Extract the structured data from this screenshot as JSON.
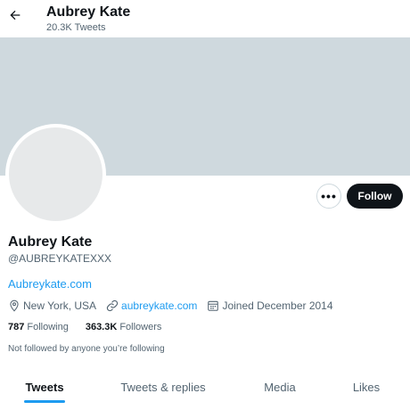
{
  "header": {
    "name": "Aubrey Kate",
    "tweet_count": "20.3K Tweets"
  },
  "actions": {
    "more": "•••",
    "follow": "Follow"
  },
  "profile": {
    "display_name": "Aubrey Kate",
    "handle": "@AUBREYKATEXXX",
    "bio_link": "Aubreykate.com",
    "location": "New York, USA",
    "website": "aubreykate.com",
    "joined": "Joined December 2014",
    "following_count": "787",
    "following_label": "Following",
    "followers_count": "363.3K",
    "followers_label": "Followers",
    "follow_note": "Not followed by anyone you’re following"
  },
  "tabs": [
    {
      "label": "Tweets",
      "active": true
    },
    {
      "label": "Tweets & replies",
      "active": false
    },
    {
      "label": "Media",
      "active": false
    },
    {
      "label": "Likes",
      "active": false
    }
  ],
  "icons": {
    "back": "arrow-left-icon",
    "location": "location-pin-icon",
    "website": "link-icon",
    "joined": "calendar-icon"
  },
  "colors": {
    "accent": "#1d9bf0",
    "text": "#0f1419",
    "muted": "#536471",
    "follow_button": "#0f1419",
    "border": "#cfd9de",
    "placeholder": "#cfd9de"
  }
}
